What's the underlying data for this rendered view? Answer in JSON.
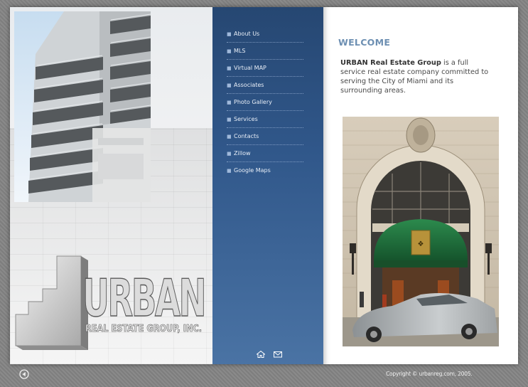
{
  "nav": {
    "items": [
      {
        "label": "About Us"
      },
      {
        "label": "MLS"
      },
      {
        "label": "Virtual MAP"
      },
      {
        "label": "Associates"
      },
      {
        "label": "Photo Gallery"
      },
      {
        "label": "Services"
      },
      {
        "label": "Contacts"
      },
      {
        "label": "Zillow"
      },
      {
        "label": "Google Maps"
      }
    ],
    "footer_icons": [
      "home-icon",
      "mail-icon"
    ]
  },
  "main": {
    "heading": "WELCOME",
    "intro_company": "URBAN Real Estate Group",
    "intro_rest": " is a full service real estate company committed to serving the City of Miami and its surrounding areas."
  },
  "logo": {
    "word": "URBAN",
    "tagline": "REAL ESTATE GROUP, INC."
  },
  "footer": {
    "copyright": "Copyright © urbanreg.com, 2005."
  },
  "colors": {
    "nav_top": "#264772",
    "nav_bottom": "#4a73a4",
    "heading": "#6d8fb2",
    "awning": "#1f6b3a"
  }
}
